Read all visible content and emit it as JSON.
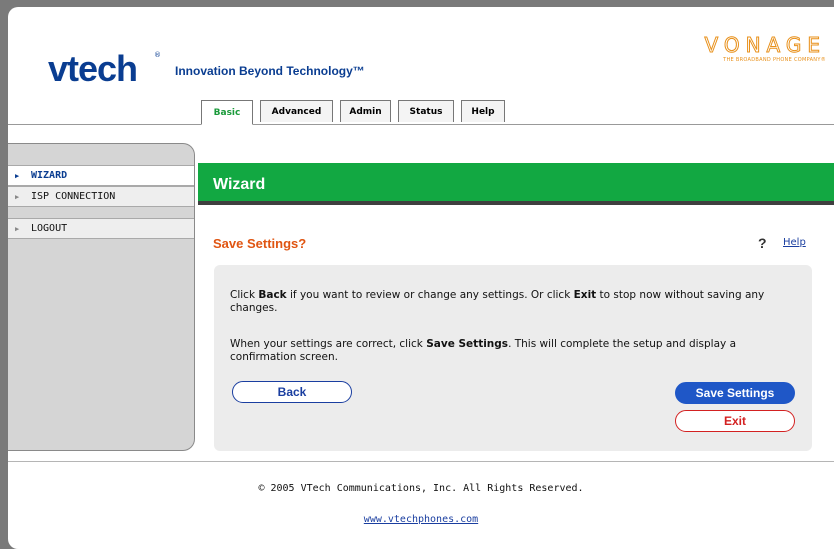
{
  "brand": {
    "logo_text": "vtech",
    "logo_mark": "®",
    "tagline": "Innovation Beyond Technology™",
    "partner_logo": "VONAGE",
    "partner_subtitle": "THE BROADBAND PHONE COMPANY®"
  },
  "tabs": [
    {
      "label": "Basic",
      "active": true
    },
    {
      "label": "Advanced",
      "active": false
    },
    {
      "label": "Admin",
      "active": false
    },
    {
      "label": "Status",
      "active": false
    },
    {
      "label": "Help",
      "active": false
    }
  ],
  "sidebar": {
    "items": [
      {
        "label": "WIZARD",
        "active": true,
        "icon": "triangle-right-icon"
      },
      {
        "label": "ISP CONNECTION",
        "active": false,
        "icon": "triangle-right-icon"
      },
      {
        "label": "LOGOUT",
        "active": false,
        "icon": "triangle-right-icon"
      }
    ]
  },
  "main": {
    "section_title": "Wizard",
    "page_title": "Save Settings?",
    "help_icon": "?",
    "help_label": "Help",
    "paragraph1": {
      "pre": "Click ",
      "b1": "Back",
      "mid": " if you want to review or change any settings. Or click ",
      "b2": "Exit",
      "post": " to stop now without saving any changes."
    },
    "paragraph2": {
      "pre": "When your settings are correct, click ",
      "b1": "Save Settings",
      "post": ". This will complete the setup and display a confirmation screen."
    },
    "buttons": {
      "back": "Back",
      "save": "Save Settings",
      "exit": "Exit"
    }
  },
  "footer": {
    "copyright": "© 2005 VTech Communications, Inc. All Rights Reserved.",
    "link": "www.vtechphones.com"
  },
  "colors": {
    "header_green": "#12a842",
    "title_orange": "#e05512",
    "brand_blue": "#0a3d91",
    "button_blue": "#1f57c7",
    "exit_red": "#d32121",
    "vonage_orange": "#e8901a"
  }
}
